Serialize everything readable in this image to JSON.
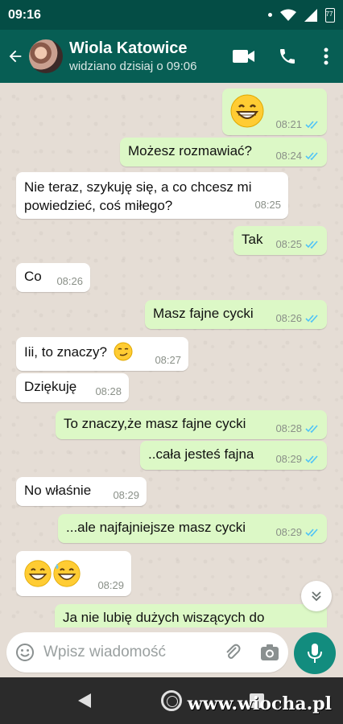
{
  "status_bar": {
    "time": "09:16",
    "battery": "77"
  },
  "header": {
    "contact_name": "Wiola Katowice",
    "last_seen": "widziano dzisiaj o 09:06",
    "icons": [
      "back-arrow-icon",
      "video-call-icon",
      "phone-icon",
      "more-vert-icon"
    ]
  },
  "messages": [
    {
      "dir": "out",
      "text": "",
      "emoji": "grin",
      "time": "08:21",
      "ticks": true
    },
    {
      "dir": "out",
      "text": "Możesz rozmawiać?",
      "time": "08:24",
      "ticks": true
    },
    {
      "dir": "in",
      "text_line1": "Nie teraz, szykuję się, a co chcesz mi",
      "text_line2": "powiedzieć, coś miłego?",
      "time": "08:25"
    },
    {
      "dir": "out",
      "text": "Tak",
      "time": "08:25",
      "ticks": true
    },
    {
      "dir": "in",
      "text": "Co",
      "time": "08:26"
    },
    {
      "dir": "out",
      "text": "Masz fajne cycki",
      "time": "08:26",
      "ticks": true
    },
    {
      "dir": "in",
      "text": "Iii, to znaczy?",
      "emoji": "smirk",
      "time": "08:27"
    },
    {
      "dir": "in",
      "text": "Dziękuję",
      "time": "08:28"
    },
    {
      "dir": "out",
      "text": "To znaczy,że masz fajne cycki",
      "time": "08:28",
      "ticks": true
    },
    {
      "dir": "out",
      "text": "..cała jesteś fajna",
      "time": "08:29",
      "ticks": true
    },
    {
      "dir": "in",
      "text": "No właśnie",
      "time": "08:29"
    },
    {
      "dir": "out",
      "text": "...ale najfajniejsze masz cycki",
      "time": "08:29",
      "ticks": true
    },
    {
      "dir": "in",
      "text": "",
      "emoji": "grin-sweat",
      "time": "08:29"
    },
    {
      "dir": "out",
      "text": "Ja nie lubię dużych wiszących do",
      "time": "",
      "ticks": false
    }
  ],
  "input": {
    "placeholder": "Wpisz wiadomość"
  },
  "colors": {
    "header": "#075e54",
    "status_bar": "#044d45",
    "outgoing_bubble": "#dcf8c6",
    "incoming_bubble": "#ffffff",
    "mic_button": "#128c7e",
    "read_ticks": "#4fc3f7"
  },
  "watermark": "www.wiocha.pl"
}
